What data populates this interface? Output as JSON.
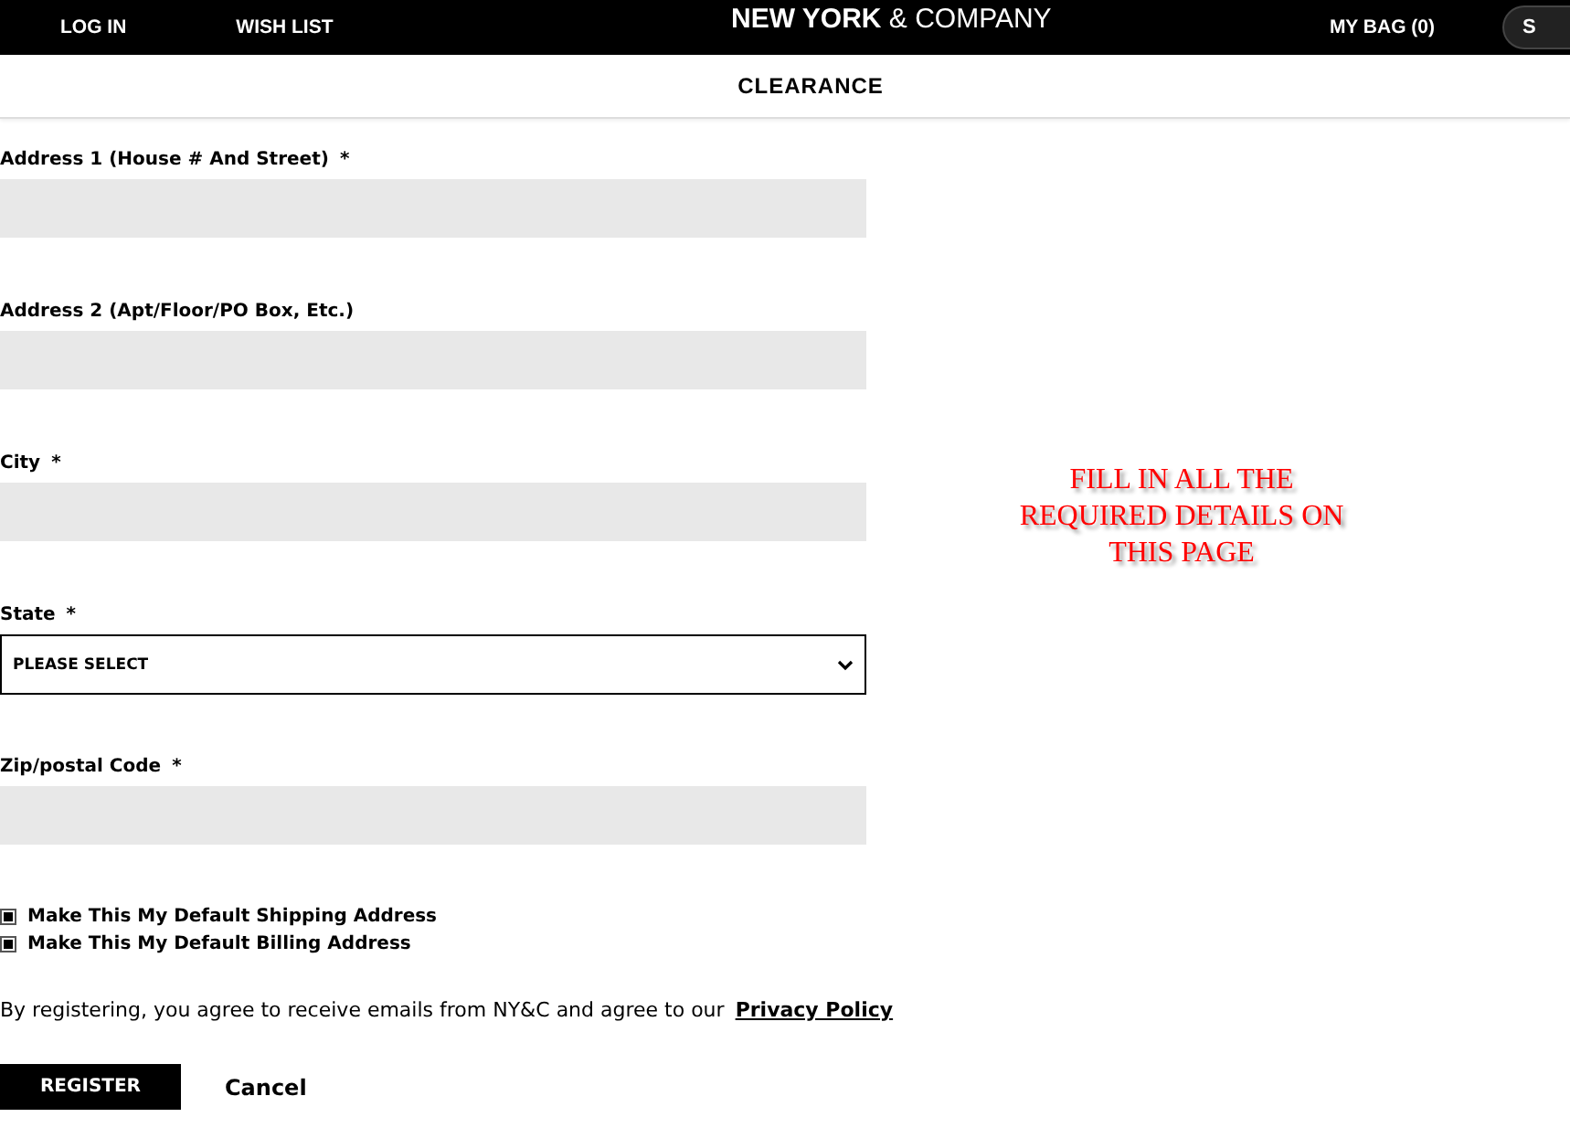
{
  "header": {
    "left_links": [
      "LOG IN",
      "WISH LIST"
    ],
    "logo": {
      "bold": "NEW YORK",
      "rest": "& COMPANY"
    },
    "bag": "MY BAG (0)",
    "right_button": "S"
  },
  "category_bar": {
    "title": "CLEARANCE"
  },
  "form": {
    "fields": [
      {
        "kind": "text",
        "label": "Address 1 (House # And Street)",
        "required_mark": "*"
      },
      {
        "kind": "text",
        "label": "Address 2 (Apt/Floor/PO Box, Etc.)"
      },
      {
        "kind": "text",
        "label": "City",
        "required_mark": "*"
      },
      {
        "kind": "select",
        "label": "State",
        "required_mark": "*",
        "value": "PLEASE SELECT"
      },
      {
        "kind": "text",
        "label": "Zip/postal Code",
        "required_mark": "*"
      }
    ],
    "checkboxes": [
      {
        "label": "Make This My Default Shipping Address",
        "checked": true
      },
      {
        "label": "Make This My Default Billing Address",
        "checked": true
      }
    ],
    "consent": {
      "text": "By registering, you agree to receive emails from NY&C and agree to our",
      "link": "Privacy Policy"
    },
    "buttons": {
      "primary": "REGISTER",
      "secondary": "Cancel"
    }
  },
  "notice": "FILL IN ALL THE REQUIRED DETAILS ON THIS PAGE"
}
